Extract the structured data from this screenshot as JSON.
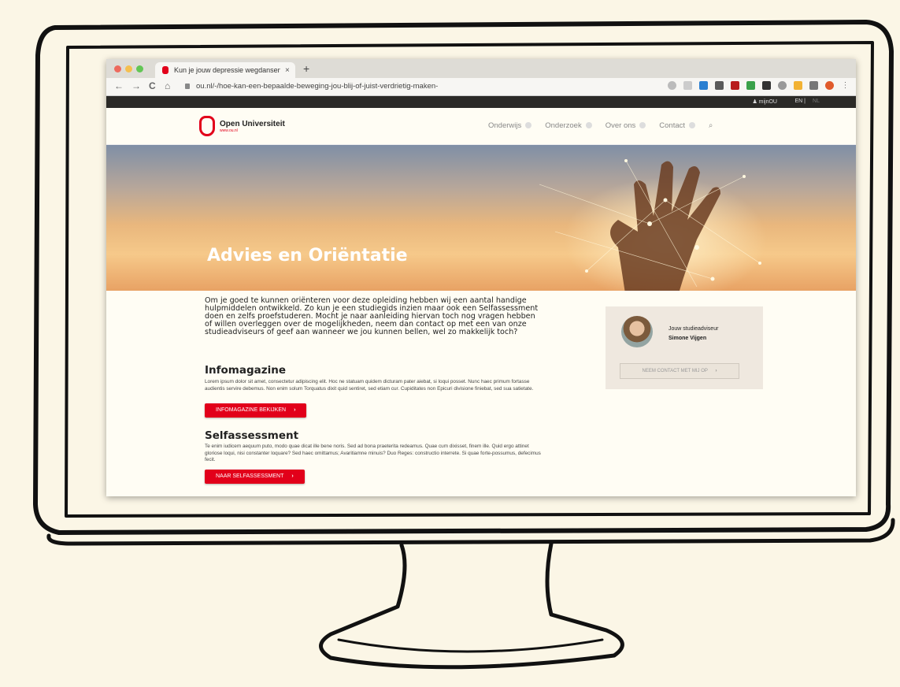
{
  "browser": {
    "tab_title": "Kun je jouw depressie wegdansen?",
    "tab_close": "×",
    "new_tab": "+",
    "url": "ou.nl/-/hoe-kan-een-bepaalde-beweging-jou-blij-of-juist-verdrietig-maken-",
    "nav_back": "←",
    "nav_forward": "→",
    "nav_reload": "C",
    "nav_home": "⌂"
  },
  "topstrip": {
    "mijn_ou": "♟ mijnOU",
    "lang_en": "EN |",
    "lang_nl": "NL"
  },
  "header": {
    "logo_name": "Open Universiteit",
    "logo_sub": "www.ou.nl",
    "menu": [
      {
        "label": "Onderwijs"
      },
      {
        "label": "Onderzoek"
      },
      {
        "label": "Over ons"
      },
      {
        "label": "Contact"
      }
    ],
    "search_icon": "⌕"
  },
  "hero": {
    "title": "Advies en Oriëntatie"
  },
  "main": {
    "intro": "Om je goed te kunnen oriënteren voor deze opleiding hebben wij een aantal handige hulpmiddelen ontwikkeld. Zo kun je een studiegids inzien maar ook een Selfassessment doen en zelfs proefstuderen. Mocht je naar aanleiding hiervan toch nog vragen hebben of willen overleggen over de mogelijkheden, neem dan contact op met een van onze studieadviseurs of geef aan wanneer we jou kunnen bellen, wel zo makkelijk toch?",
    "sections": [
      {
        "title": "Infomagazine",
        "body": "Lorem ipsum dolor sit amet, consectetur adipiscing elit. Hoc ne statuam quidem dicturam pater aiebat, si loqui posset. Nunc haec primum fortasse audientis servire debemus. Non enim solum Torquatus dixit quid sentiret, sed etiam cur. Cupiditates non Epicuri divisione finiebat, sed sua satietate.",
        "button": "INFOMAGAZINE BEKIJKEN"
      },
      {
        "title": "Selfassessment",
        "body": "Te enim iudicem aequum puto, modo quae dicat ille bene noris. Sed ad bona praeterita redeamus. Quae cum dixisset, finem ille. Quid ergo attinet gloriose loqui, nisi constanter loquare? Sed haec omittamus; Avaritiamne minuis? Duo Reges: constructio interrete. Si quae forte-possumus, defecimus fecit.",
        "button": "NAAR SELFASSESSMENT"
      }
    ],
    "chevron": "›"
  },
  "advisor": {
    "label": "Jouw studieadviseur",
    "name": "Simone Vijgen",
    "button": "NEEM CONTACT MET MIJ OP",
    "chevron": "›"
  },
  "colors": {
    "accent": "#e2001a",
    "background": "#fbf6e6"
  }
}
